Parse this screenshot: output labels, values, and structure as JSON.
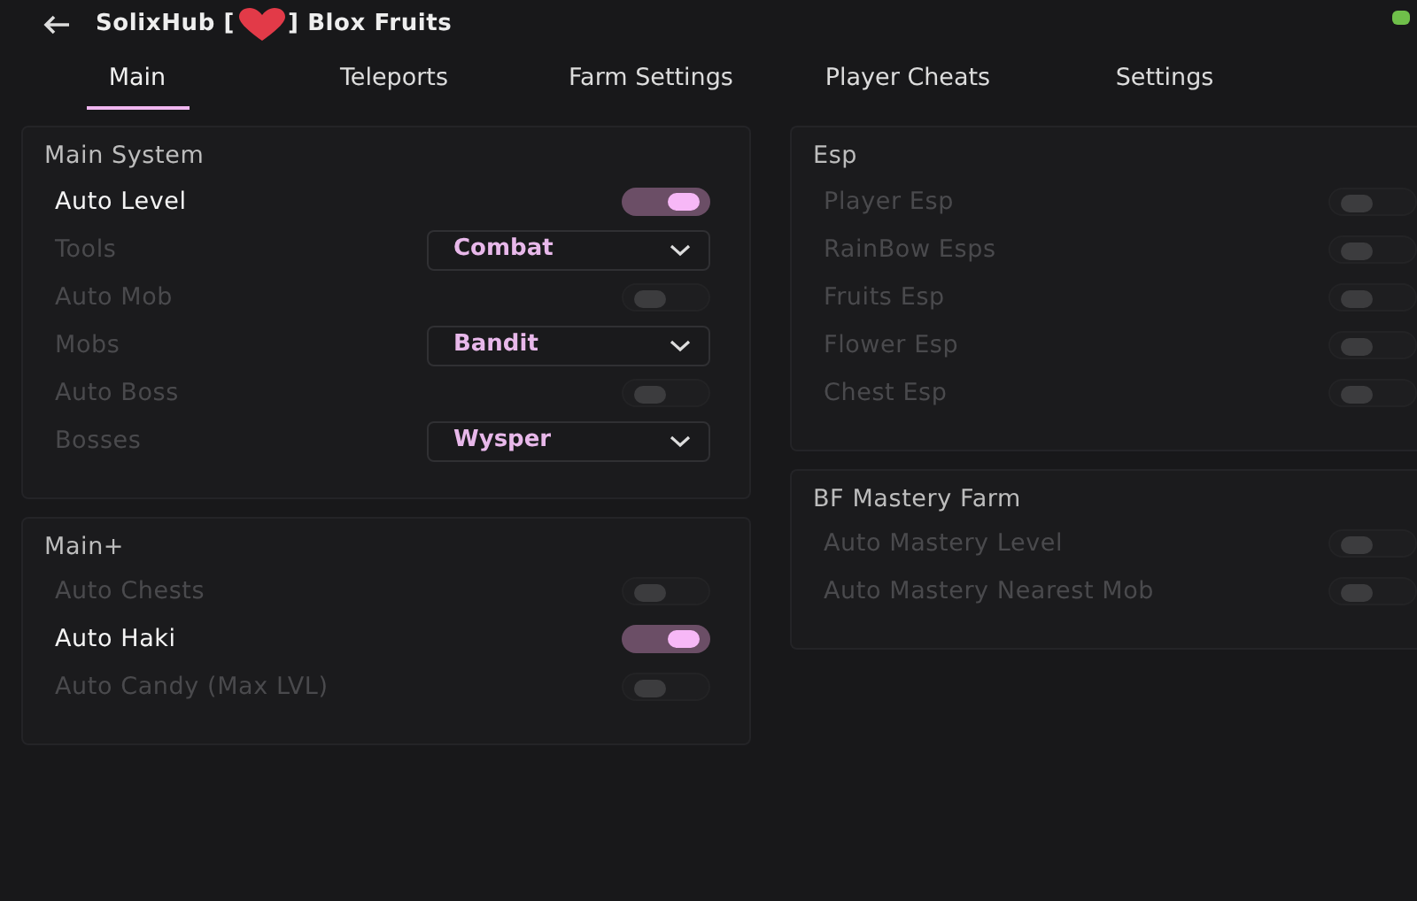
{
  "header": {
    "title_before": "SolixHub [",
    "title_after": "] Blox Fruits"
  },
  "tabs": [
    {
      "label": "Main",
      "selected": true
    },
    {
      "label": "Teleports",
      "selected": false
    },
    {
      "label": "Farm Settings",
      "selected": false
    },
    {
      "label": "Player Cheats",
      "selected": false
    },
    {
      "label": "Settings",
      "selected": false
    }
  ],
  "columns": [
    [
      {
        "title": "Main System",
        "rows": [
          {
            "kind": "toggle",
            "label": "Auto Level",
            "on": true
          },
          {
            "kind": "dropdown",
            "label": "Tools",
            "value": "Combat"
          },
          {
            "kind": "toggle",
            "label": "Auto Mob",
            "on": false
          },
          {
            "kind": "dropdown",
            "label": "Mobs",
            "value": "Bandit"
          },
          {
            "kind": "toggle",
            "label": "Auto Boss",
            "on": false
          },
          {
            "kind": "dropdown",
            "label": "Bosses",
            "value": "Wysper"
          }
        ]
      },
      {
        "title": "Main+",
        "rows": [
          {
            "kind": "toggle",
            "label": "Auto Chests",
            "on": false
          },
          {
            "kind": "toggle",
            "label": "Auto Haki",
            "on": true
          },
          {
            "kind": "toggle",
            "label": "Auto Candy (Max LVL)",
            "on": false
          }
        ]
      }
    ],
    [
      {
        "title": "Esp",
        "rows": [
          {
            "kind": "toggle",
            "label": "Player Esp",
            "on": false
          },
          {
            "kind": "toggle",
            "label": "RainBow Esps",
            "on": false
          },
          {
            "kind": "toggle",
            "label": "Fruits Esp",
            "on": false
          },
          {
            "kind": "toggle",
            "label": "Flower Esp",
            "on": false
          },
          {
            "kind": "toggle",
            "label": "Chest Esp",
            "on": false
          }
        ]
      },
      {
        "title": "BF Mastery Farm",
        "rows": [
          {
            "kind": "toggle",
            "label": "Auto Mastery Level",
            "on": false
          },
          {
            "kind": "toggle",
            "label": "Auto Mastery Nearest Mob",
            "on": false
          }
        ]
      }
    ]
  ]
}
